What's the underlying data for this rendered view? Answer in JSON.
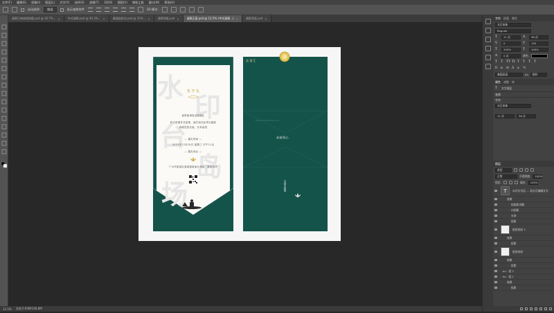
{
  "menu": [
    "文件(F)",
    "编辑(E)",
    "图像(I)",
    "图层(L)",
    "文字(Y)",
    "选择(S)",
    "滤镜(T)",
    "3D(D)",
    "视图(V)",
    "增效工具",
    "窗口(W)",
    "帮助(H)"
  ],
  "options": {
    "auto_select_label": "自动选择:",
    "auto_select_value": "图层",
    "transform_label": "显示变换控件",
    "mode_label": "3D 模式:"
  },
  "tabs": [
    {
      "label": "请柬已有按钮排版.psd @ 16.7%...",
      "active": false
    },
    {
      "label": "中式请柬.psd @ 30.3%...",
      "active": false
    },
    {
      "label": "邀请函样式.psd @ 31%...",
      "active": false
    },
    {
      "label": "请柬排版.psd",
      "active": false
    },
    {
      "label": "请柬正面.psd @ 12.5% (中式请柬...)",
      "active": true
    },
    {
      "label": "请柬背面.psd",
      "active": false
    }
  ],
  "status": {
    "zoom": "12.5%",
    "doc": "文档:5.93M/100.8M"
  },
  "front": {
    "title": "东 于 礼",
    "big_chars": [
      "水",
      "印",
      "台",
      "岛",
      "场"
    ],
    "lines": [
      "诚挚邀请您出席婚礼",
      "时光荏苒岁月如歌，我们将在此举办婚宴",
      "恭候您的光临，共享喜悦",
      "— 婚礼时间 —",
      "2022年12月28日 星期三 中午12点",
      "— 婚礼地点 —",
      "广州市某某区某某路某某大酒店二楼宴会厅"
    ]
  },
  "back": {
    "logo": "吉 语 汇",
    "center_text": "永结同心",
    "side_text": "白首不相离"
  },
  "panels": {
    "top_tabs": [
      "字符",
      "段落",
      "属性"
    ],
    "font_family": "方正宋体",
    "font_style": "Regular",
    "font_size": "11 点",
    "leading": "36 点",
    "kerning": "0",
    "tracking": "100",
    "scale_v": "100%",
    "scale_h": "100%",
    "baseline": "0 点",
    "color_label": "颜色:",
    "language": "美国英语",
    "aa": "锐利",
    "props_tabs": [
      "属性",
      "调整",
      "库"
    ],
    "props_title": "文字图层",
    "props_sections": [
      "变换",
      "字符"
    ],
    "props_font": "方正宋体",
    "props_size": "11 点",
    "props_leading": "36 点",
    "layers_tab": "图层",
    "layers_kind": "类型",
    "blend": "正常",
    "opacity_label": "不透明度:",
    "opacity": "100%",
    "lock_label": "锁定:",
    "fill_label": "填充:",
    "fill": "100%",
    "layers": [
      {
        "name": "水印文字层 — 双击可编辑文字",
        "big": true,
        "indent": 0
      },
      {
        "name": "效果",
        "big": false,
        "indent": 1
      },
      {
        "name": "斜面和浮雕",
        "big": false,
        "indent": 2
      },
      {
        "name": "内阴影",
        "big": false,
        "indent": 2
      },
      {
        "name": "光泽",
        "big": false,
        "indent": 2
      },
      {
        "name": "投影",
        "big": false,
        "indent": 2
      },
      {
        "name": "纸质底纹 2",
        "big": true,
        "indent": 0
      },
      {
        "name": "效果",
        "big": false,
        "indent": 1
      },
      {
        "name": "投影",
        "big": false,
        "indent": 2
      },
      {
        "name": "纸质底纹",
        "big": true,
        "indent": 0
      },
      {
        "name": "效果",
        "big": false,
        "indent": 1
      },
      {
        "name": "投影",
        "big": false,
        "indent": 2
      },
      {
        "name": "组 2",
        "big": false,
        "indent": 0
      },
      {
        "name": "组 1",
        "big": false,
        "indent": 0
      },
      {
        "name": "效果",
        "big": false,
        "indent": 1
      },
      {
        "name": "投影",
        "big": false,
        "indent": 2
      }
    ]
  },
  "colors": {
    "accent_green": "#14534a",
    "gold": "#c9a23a"
  }
}
